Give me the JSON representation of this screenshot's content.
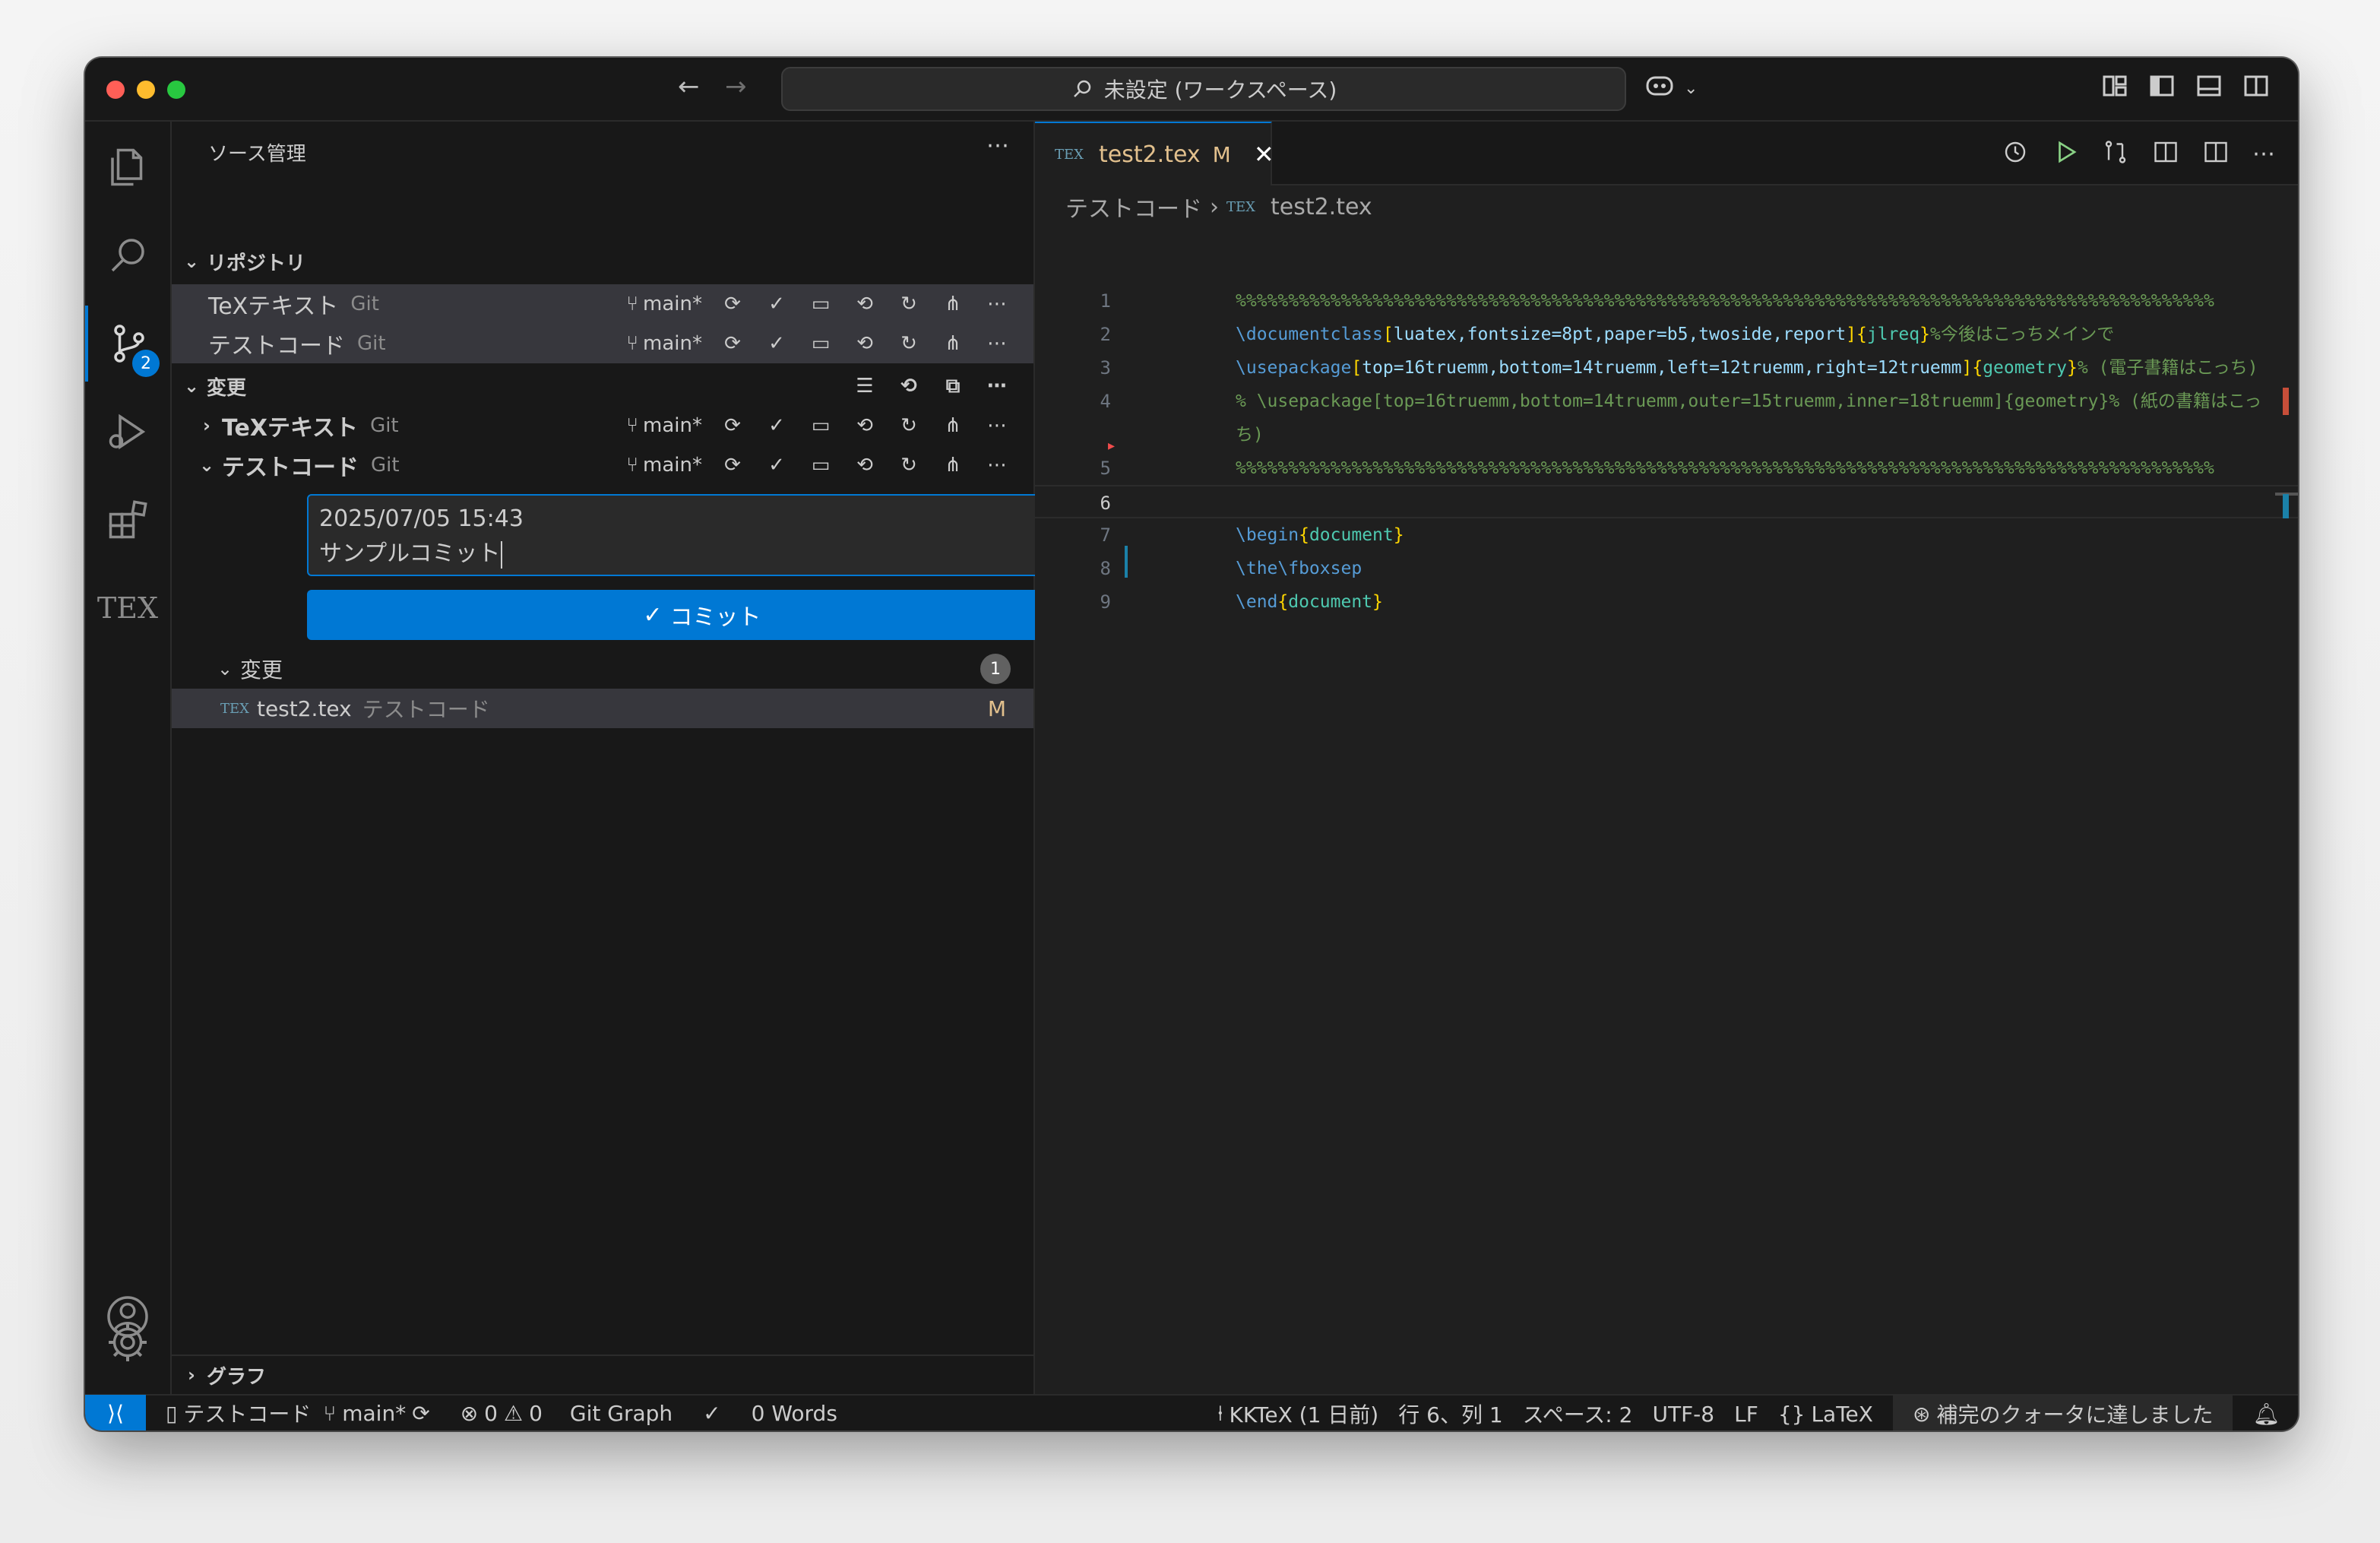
{
  "titlebar": {
    "search_text": "未設定 (ワークスペース)"
  },
  "activity": {
    "source_control_badge": "2",
    "tex_label": "TEX"
  },
  "sidebar": {
    "title": "ソース管理",
    "repositories_header": "リポジトリ",
    "repositories": [
      {
        "name": "TeXテキスト",
        "provider": "Git",
        "branch": "main*"
      },
      {
        "name": "テストコード",
        "provider": "Git",
        "branch": "main*"
      }
    ],
    "changes_header": "変更",
    "change_groups": [
      {
        "name": "TeXテキスト",
        "provider": "Git",
        "branch": "main*"
      },
      {
        "name": "テストコード",
        "provider": "Git",
        "branch": "main*"
      }
    ],
    "commit_message_line1": "2025/07/05 15:43",
    "commit_message_line2": "サンプルコミット",
    "commit_button": "コミット",
    "changes_subheader": "変更",
    "changes_count": "1",
    "file": {
      "name": "test2.tex",
      "folder": "テストコード",
      "status": "M",
      "icon_label": "TEX"
    },
    "graph_header": "グラフ"
  },
  "editor": {
    "tab": {
      "label": "test2.tex",
      "status": "M",
      "icon_label": "TEX"
    },
    "breadcrumb_folder": "テストコード",
    "breadcrumb_file": "test2.tex",
    "lines": [
      {
        "n": "1",
        "parts": [
          [
            "c-comment",
            "%%%%%%%%%%%%%%%%%%%%%%%%%%%%%%%%%%%%%%%%%%%%%%%%%%%%%%%%%%%%%%%%%%%%%%%%%%%%%%%%%%%%%%%%%%%%%"
          ]
        ]
      },
      {
        "n": "2",
        "parts": [
          [
            "c-cmd",
            "\\documentclass"
          ],
          [
            "c-brace",
            "["
          ],
          [
            "c-str",
            "luatex,fontsize=8pt,paper=b5,twoside,report"
          ],
          [
            "c-brace",
            "]{"
          ],
          [
            "c-arg",
            "jlreq"
          ],
          [
            "c-brace",
            "}"
          ],
          [
            "c-comment",
            "%今後はこっちメインで"
          ]
        ]
      },
      {
        "n": "3",
        "parts": [
          [
            "c-cmd",
            "\\usepackage"
          ],
          [
            "c-brace",
            "["
          ],
          [
            "c-str",
            "top=16truemm,bottom=14truemm,left=12truemm,right=12truemm"
          ],
          [
            "c-brace",
            "]{"
          ],
          [
            "c-arg",
            "geometry"
          ],
          [
            "c-brace",
            "}"
          ],
          [
            "c-comment",
            "% (電子書籍はこっち)"
          ]
        ]
      },
      {
        "n": "4",
        "parts": [
          [
            "c-comment",
            "% \\usepackage[top=16truemm,bottom=14truemm,outer=15truemm,inner=18truemm]{geometry}% (紙の書籍はこっ"
          ]
        ]
      },
      {
        "n": "",
        "parts": [
          [
            "c-comment",
            "ち)"
          ]
        ]
      },
      {
        "n": "5",
        "parts": [
          [
            "c-comment",
            "%%%%%%%%%%%%%%%%%%%%%%%%%%%%%%%%%%%%%%%%%%%%%%%%%%%%%%%%%%%%%%%%%%%%%%%%%%%%%%%%%%%%%%%%%%%%%"
          ]
        ]
      },
      {
        "n": "6",
        "parts": []
      },
      {
        "n": "7",
        "parts": [
          [
            "c-cmd",
            "\\begin"
          ],
          [
            "c-brace",
            "{"
          ],
          [
            "c-arg",
            "document"
          ],
          [
            "c-brace",
            "}"
          ]
        ]
      },
      {
        "n": "8",
        "parts": [
          [
            "c-cmd",
            "\\the\\fboxsep"
          ]
        ]
      },
      {
        "n": "9",
        "parts": [
          [
            "c-cmd",
            "\\end"
          ],
          [
            "c-brace",
            "{"
          ],
          [
            "c-arg",
            "document"
          ],
          [
            "c-brace",
            "}"
          ]
        ]
      }
    ]
  },
  "statusbar": {
    "repo": "テストコード",
    "branch": "main*",
    "errors": "0",
    "warnings": "0",
    "git_graph": "Git Graph",
    "words": "0 Words",
    "kktex": "KKTeX (1 日前)",
    "position": "行 6、列 1",
    "spaces": "スペース: 2",
    "encoding": "UTF-8",
    "eol": "LF",
    "language": "LaTeX",
    "quota": "補完のクォータに達しました"
  },
  "colors": {
    "accent": "#0078d4",
    "modified": "#e2c08d",
    "comment": "#6a9955"
  }
}
